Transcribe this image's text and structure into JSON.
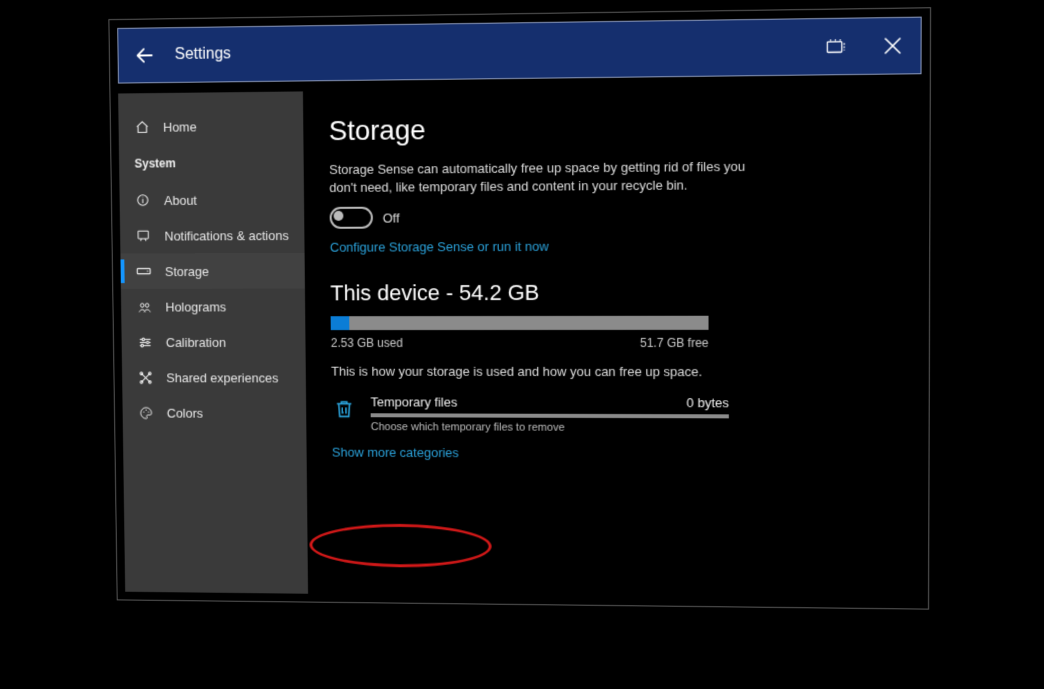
{
  "titlebar": {
    "title": "Settings"
  },
  "sidebar": {
    "home": "Home",
    "section": "System",
    "items": [
      {
        "label": "About"
      },
      {
        "label": "Notifications & actions"
      },
      {
        "label": "Storage"
      },
      {
        "label": "Holograms"
      },
      {
        "label": "Calibration"
      },
      {
        "label": "Shared experiences"
      },
      {
        "label": "Colors"
      }
    ]
  },
  "main": {
    "page_title": "Storage",
    "sense_desc": "Storage Sense can automatically free up space by getting rid of files you don't need, like temporary files and content in your recycle bin.",
    "toggle_state": "Off",
    "configure_link": "Configure Storage Sense or run it now",
    "device_heading": "This device - 54.2 GB",
    "used_label": "2.53 GB used",
    "free_label": "51.7 GB free",
    "used_fraction_percent": 5,
    "howused": "This is how your storage is used and how you can free up space.",
    "categories": [
      {
        "name": "Temporary files",
        "size": "0 bytes",
        "sub": "Choose which temporary files to remove"
      }
    ],
    "show_more": "Show more categories"
  },
  "colors": {
    "accent": "#1496ff",
    "link": "#2aa0d8",
    "titlebar": "#152f6e",
    "sidebar": "#3a3a3a"
  }
}
